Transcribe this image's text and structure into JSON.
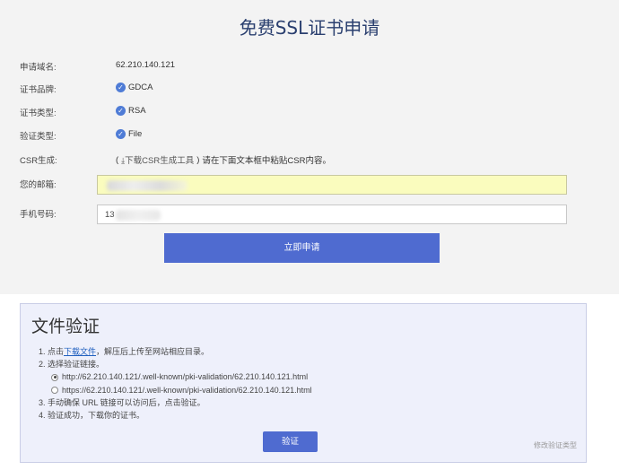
{
  "page": {
    "title": "免费SSL证书申请"
  },
  "form": {
    "domain": {
      "label": "申请域名:",
      "value": "62.210.140.121"
    },
    "brand": {
      "label": "证书品牌:",
      "value": "GDCA"
    },
    "cert_type": {
      "label": "证书类型:",
      "value": "RSA"
    },
    "verify_type": {
      "label": "验证类型:",
      "value": "File"
    },
    "csr": {
      "label": "CSR生成:",
      "open": "(",
      "link": "下载CSR生成工具",
      "close": ")",
      "text": "请在下面文本框中粘贴CSR内容。"
    },
    "email": {
      "label": "您的邮箱:",
      "value": ""
    },
    "phone": {
      "label": "手机号码:",
      "value": "13"
    },
    "submit": "立即申请"
  },
  "verification": {
    "title": "文件验证",
    "step1_prefix": "1. 点击",
    "step1_link": "下载文件",
    "step1_suffix": "，解压后上传至网站相应目录。",
    "step2": "2. 选择验证链接。",
    "options": [
      {
        "label": "http://62.210.140.121/.well-known/pki-validation/62.210.140.121.html",
        "selected": true
      },
      {
        "label": "https://62.210.140.121/.well-known/pki-validation/62.210.140.121.html",
        "selected": false
      }
    ],
    "step3": "3. 手动确保 URL 链接可以访问后，点击验证。",
    "step4": "4. 验证成功，下载你的证书。",
    "verify_button": "验证",
    "modify_link": "修改验证类型"
  }
}
